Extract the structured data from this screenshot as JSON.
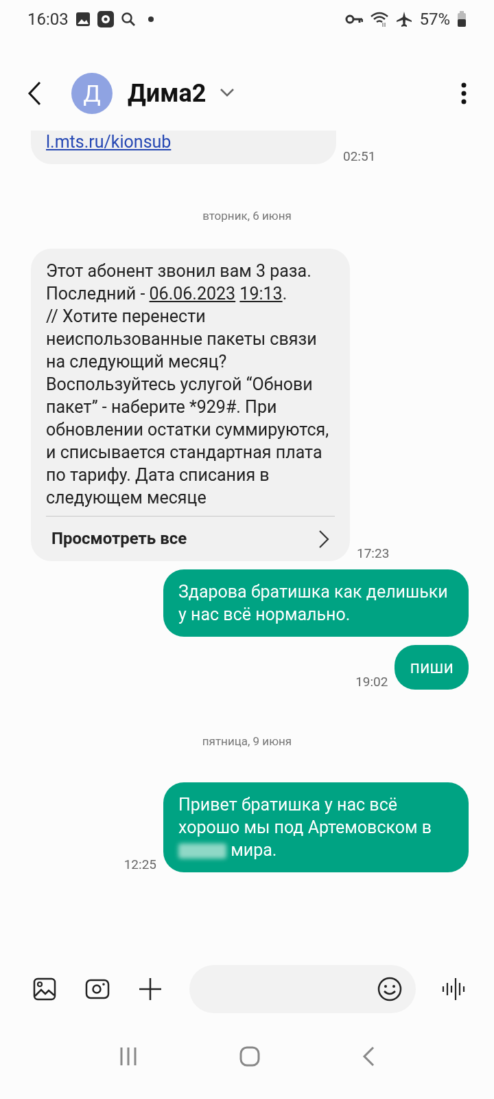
{
  "status_bar": {
    "time": "16:03",
    "battery": "57%"
  },
  "header": {
    "contact_name": "Дима2",
    "avatar_letter": "Д"
  },
  "messages": [
    {
      "kind": "incoming",
      "clipped_top": true,
      "time": "02:51",
      "segments": [
        {
          "kind": "link",
          "text": "l.mts.ru/kionsub"
        }
      ]
    },
    {
      "kind": "date",
      "text": "вторник, 6 июня"
    },
    {
      "kind": "incoming",
      "clipped_top": false,
      "time": "17:23",
      "more_button": "Просмотреть все",
      "segments": [
        {
          "kind": "text",
          "text": "Этот абонент звонил вам 3 раза. Последний - "
        },
        {
          "kind": "link",
          "text": "06.06.2023"
        },
        {
          "kind": "link",
          "text": "19:13"
        },
        {
          "kind": "text",
          "text": ".\n// Хотите перенести неиспользованные пакеты связи на следующий месяц? Воспользуйтесь услугой “Обнови пакет” - наберите *929#. При обновлении остатки суммируются, и списывается стандартная плата по тарифу. Дата списания в следующем месяце"
        }
      ]
    },
    {
      "kind": "outgoing",
      "segments": [
        {
          "kind": "text",
          "text": "Здарова братишка как делишьки у нас всё нормально."
        }
      ]
    },
    {
      "kind": "outgoing",
      "time": "19:02",
      "segments": [
        {
          "kind": "text",
          "text": "пиши"
        }
      ]
    },
    {
      "kind": "date",
      "text": "пятница, 9 июня"
    },
    {
      "kind": "outgoing",
      "time": "12:25",
      "segments": [
        {
          "kind": "text",
          "text": "Привет братишка у нас всё хорошо мы под Артемовском в "
        },
        {
          "kind": "redacted"
        },
        {
          "kind": "text",
          "text": " мира."
        }
      ]
    }
  ]
}
